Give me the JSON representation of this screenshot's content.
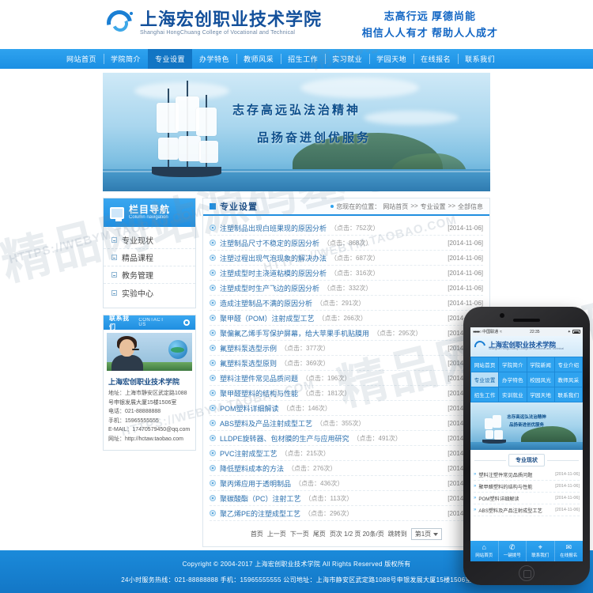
{
  "site": {
    "logo_cn": "上海宏创职业技术学院",
    "logo_en": "Shanghai HongChuang College of Vocational and Technical",
    "slogan_line1": "志高行远 厚德尚能",
    "slogan_line2": "相信人人有才 帮助人人成才"
  },
  "nav": {
    "items": [
      {
        "label": "网站首页",
        "active": false
      },
      {
        "label": "学院简介",
        "active": false
      },
      {
        "label": "专业设置",
        "active": true
      },
      {
        "label": "办学特色",
        "active": false
      },
      {
        "label": "教师风采",
        "active": false
      },
      {
        "label": "招生工作",
        "active": false
      },
      {
        "label": "实习就业",
        "active": false
      },
      {
        "label": "学园天地",
        "active": false
      },
      {
        "label": "在线报名",
        "active": false
      },
      {
        "label": "联系我们",
        "active": false
      }
    ]
  },
  "banner": {
    "line1": "志存高远弘法治精神",
    "line2": "品扬奋进创优服务"
  },
  "sidebar": {
    "nav_title_cn": "栏目导航",
    "nav_title_en": "Column navigation",
    "items": [
      {
        "label": "专业现状"
      },
      {
        "label": "精品课程"
      },
      {
        "label": "教务管理"
      },
      {
        "label": "实验中心"
      }
    ],
    "contact_title_cn": "联系我们",
    "contact_title_en": "CONTACT US",
    "company": "上海宏创职业技术学院",
    "address": "地址：上海市静安区武定路1088号申银发展大厦15楼1506室",
    "tel": "电话：021-88888888",
    "mobile": "手机：15965555555",
    "email": "E-MAIL：17470579450@qq.com",
    "web": "网址：http://hctaw.taobao.com"
  },
  "main": {
    "title": "专业设置",
    "breadcrumb_label": "您现在的位置：",
    "breadcrumb": [
      "网站首页",
      "专业设置",
      "全部信息"
    ],
    "breadcrumb_sep": ">>",
    "list": [
      {
        "title": "注塑制品出现白班果现的原因分析",
        "hits": "（点击：752次）",
        "date": "[2014-11-06]"
      },
      {
        "title": "注塑制品尺寸不稳定的原因分析",
        "hits": "（点击：868次）",
        "date": "[2014-11-06]"
      },
      {
        "title": "注塑过程出现气泡现象的解决办法",
        "hits": "（点击：687次）",
        "date": "[2014-11-06]"
      },
      {
        "title": "注塑成型时主浇道粘模的原因分析",
        "hits": "（点击：316次）",
        "date": "[2014-11-06]"
      },
      {
        "title": "注塑成型时生产飞边的原因分析",
        "hits": "（点击：332次）",
        "date": "[2014-11-06]"
      },
      {
        "title": "造成注塑制品不满的原因分析",
        "hits": "（点击：291次）",
        "date": "[2014-11-06]"
      },
      {
        "title": "聚甲醛（POM）注射成型工艺",
        "hits": "（点击：266次）",
        "date": "[2014-11-06]"
      },
      {
        "title": "聚偏氟乙烯手写保护屏幕，给大苹果手机贴膜用",
        "hits": "（点击：295次）",
        "date": "[2014-11-06]"
      },
      {
        "title": "氟塑料泵选型示例",
        "hits": "（点击：377次）",
        "date": "[2014-11-06]"
      },
      {
        "title": "氟塑料泵选型原则",
        "hits": "（点击：369次）",
        "date": "[2014-11-06]"
      },
      {
        "title": "塑料注塑件常见品质问题",
        "hits": "（点击：196次）",
        "date": "[2014-11-06]"
      },
      {
        "title": "聚甲醛塑料的结构与性能",
        "hits": "（点击：181次）",
        "date": "[2014-11-06]"
      },
      {
        "title": "POM塑料详细解读",
        "hits": "（点击：146次）",
        "date": "[2014-11-06]"
      },
      {
        "title": "ABS塑料及产品注射成型工艺",
        "hits": "（点击：355次）",
        "date": "[2014-11-06]"
      },
      {
        "title": "LLDPE旋转器、包材膜的生产与应用研究",
        "hits": "（点击：491次）",
        "date": "[2014-11-06]"
      },
      {
        "title": "PVC注射成型工艺",
        "hits": "（点击：215次）",
        "date": "[2014-11-06]"
      },
      {
        "title": "降低塑料成本的方法",
        "hits": "（点击：276次）",
        "date": "[2014-11-06]"
      },
      {
        "title": "聚丙烯应用于透明制品",
        "hits": "（点击：436次）",
        "date": "[2014-11-06]"
      },
      {
        "title": "聚碳酸酯（PC）注射工艺",
        "hits": "（点击：113次）",
        "date": "[2014-11-06]"
      },
      {
        "title": "聚乙烯PE的注塑成型工艺",
        "hits": "（点击：296次）",
        "date": "[2014-11-06]"
      }
    ]
  },
  "pager": {
    "first": "首页",
    "prev": "上一页",
    "next": "下一页",
    "last": "尾页",
    "info": "页次 1/2 页 20条/页",
    "jump_label": "跳转到",
    "current": "第1页"
  },
  "footer": {
    "line1": "Copyright © 2004-2017 上海宏创职业技术学院 All Rights Reserved 版权所有",
    "line2": "24小时服务热线：021-88888888 手机：15965555555 公司地址：上海市静安区武定路1088号申银发展大厦15楼1506室"
  },
  "phone": {
    "status_carrier": "中国联通",
    "status_time": "22:35",
    "logo_cn": "上海宏创职业技术学院",
    "logo_en": "Shanghai HongChuang College of Vocational and Technical",
    "nav": [
      {
        "label": "网站首页",
        "active": false
      },
      {
        "label": "学院简介",
        "active": false
      },
      {
        "label": "学院新闻",
        "active": false
      },
      {
        "label": "专业介绍",
        "active": false
      },
      {
        "label": "专业设置",
        "active": true
      },
      {
        "label": "办学特色",
        "active": false
      },
      {
        "label": "校园风光",
        "active": false
      },
      {
        "label": "教师风采",
        "active": false
      },
      {
        "label": "招生工作",
        "active": false
      },
      {
        "label": "实训就业",
        "active": false
      },
      {
        "label": "学园天地",
        "active": false
      },
      {
        "label": "联系我们",
        "active": false
      }
    ],
    "banner_line1": "志存高远弘法治精神",
    "banner_line2": "品扬奋进创优服务",
    "section_title": "专业现状",
    "list": [
      {
        "title": "塑料注塑件常见品质问题",
        "date": "[2014-11-06]"
      },
      {
        "title": "聚甲醛塑料的结构与性能",
        "date": "[2014-11-06]"
      },
      {
        "title": "POM塑料详细解读",
        "date": "[2014-11-06]"
      },
      {
        "title": "ABS塑料及产品注射成型工艺",
        "date": "[2014-11-06]"
      }
    ],
    "tabs": [
      {
        "label": "网站首页",
        "icon": "home-icon",
        "glyph": "⌂"
      },
      {
        "label": "一键拨号",
        "icon": "phone-icon",
        "glyph": "✆"
      },
      {
        "label": "联系我们",
        "icon": "location-icon",
        "glyph": "⌖"
      },
      {
        "label": "在线报名",
        "icon": "chat-icon",
        "glyph": "✉"
      }
    ]
  },
  "watermarks": {
    "w1": "精品网站源码基地",
    "w2": "HTTPS://WEBYM.TAOBAO.COM"
  },
  "colors": {
    "brand_blue": "#1f8ee0",
    "nav_blue": "#2fa3ef",
    "title_dark": "#13509b"
  }
}
